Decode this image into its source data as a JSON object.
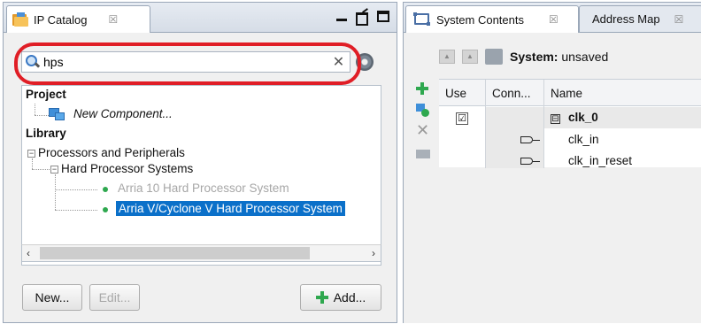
{
  "ip_catalog": {
    "tab_label": "IP Catalog",
    "tab_close_glyph": "☒",
    "search": {
      "value": "hps",
      "placeholder": ""
    },
    "tree": {
      "project_label": "Project",
      "new_component_label": "New Component...",
      "library_label": "Library",
      "processors_label": "Processors and Peripherals",
      "hps_label": "Hard Processor Systems",
      "items": [
        {
          "label": "Arria 10 Hard Processor System",
          "enabled": false,
          "selected": false
        },
        {
          "label": "Arria V/Cyclone V Hard Processor System",
          "enabled": true,
          "selected": true
        }
      ]
    },
    "buttons": {
      "new": "New...",
      "edit": "Edit...",
      "add": "Add..."
    }
  },
  "system_contents": {
    "tab_label": "System Contents",
    "tab_close_glyph": "☒",
    "address_map_tab": "Address Map",
    "system_prefix": "System:",
    "system_name": "unsaved",
    "columns": [
      "Use",
      "Conn...",
      "Name"
    ],
    "rows": [
      {
        "name": "clk_0",
        "use": "☑",
        "bold": true,
        "expander": "⊟"
      },
      {
        "name": "clk_in"
      },
      {
        "name": "clk_in_reset"
      }
    ]
  },
  "colors": {
    "selection": "#0b70c9",
    "highlight_ring": "#e01e26",
    "add_green": "#2fa84f"
  }
}
